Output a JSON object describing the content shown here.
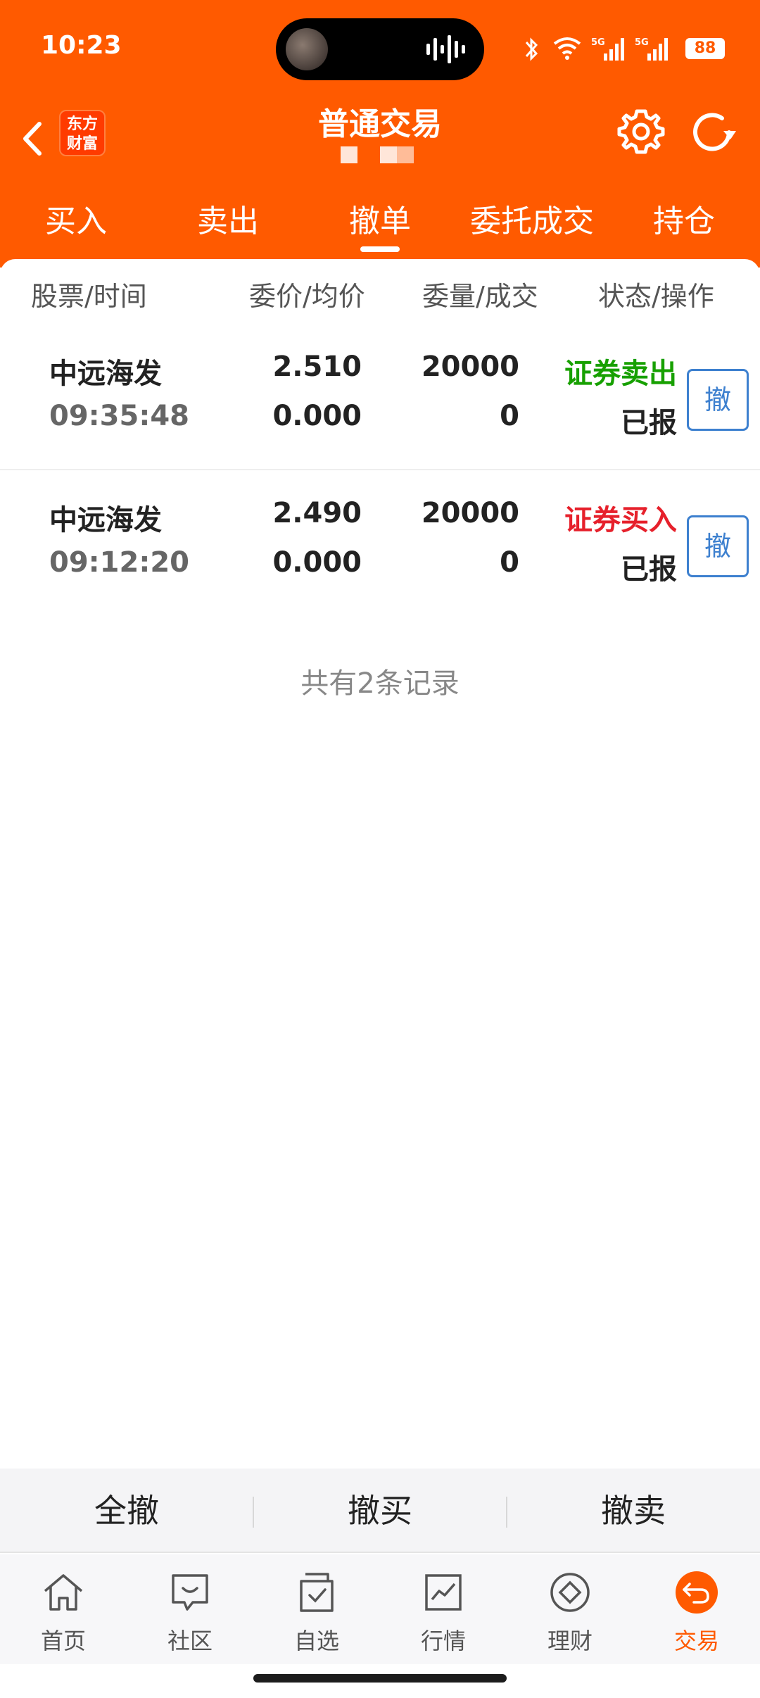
{
  "status_bar": {
    "time": "10:23",
    "battery": "88",
    "icons": [
      "bluetooth-icon",
      "wifi-icon",
      "signal-5g-icon",
      "signal-5g-icon"
    ]
  },
  "header": {
    "title": "普通交易",
    "logo_line1": "东方",
    "logo_line2": "财富"
  },
  "tabs": [
    {
      "label": "买入"
    },
    {
      "label": "卖出"
    },
    {
      "label": "撤单",
      "active": true
    },
    {
      "label": "委托成交"
    },
    {
      "label": "持仓"
    }
  ],
  "columns": {
    "col1": "股票/时间",
    "col2": "委价/均价",
    "col3": "委量/成交",
    "col4": "状态/操作"
  },
  "orders": [
    {
      "name": "中远海发",
      "time": "09:35:48",
      "price": "2.510",
      "avg_price": "0.000",
      "qty": "20000",
      "filled": "0",
      "type": "证券卖出",
      "status": "已报",
      "cancel_label": "撤"
    },
    {
      "name": "中远海发",
      "time": "09:12:20",
      "price": "2.490",
      "avg_price": "0.000",
      "qty": "20000",
      "filled": "0",
      "type": "证券买入",
      "status": "已报",
      "cancel_label": "撤"
    }
  ],
  "record_count": "共有2条记录",
  "actions": {
    "cancel_all": "全撤",
    "cancel_buy": "撤买",
    "cancel_sell": "撤卖"
  },
  "bottom_nav": [
    {
      "label": "首页",
      "icon": "home-icon"
    },
    {
      "label": "社区",
      "icon": "community-icon"
    },
    {
      "label": "自选",
      "icon": "watchlist-icon"
    },
    {
      "label": "行情",
      "icon": "market-icon"
    },
    {
      "label": "理财",
      "icon": "wealth-icon"
    },
    {
      "label": "交易",
      "icon": "trade-icon",
      "active": true
    }
  ],
  "colors": {
    "brand": "#ff5a00",
    "sell": "#17a000",
    "buy": "#e6202b",
    "cancel_button": "#3d80cf"
  }
}
